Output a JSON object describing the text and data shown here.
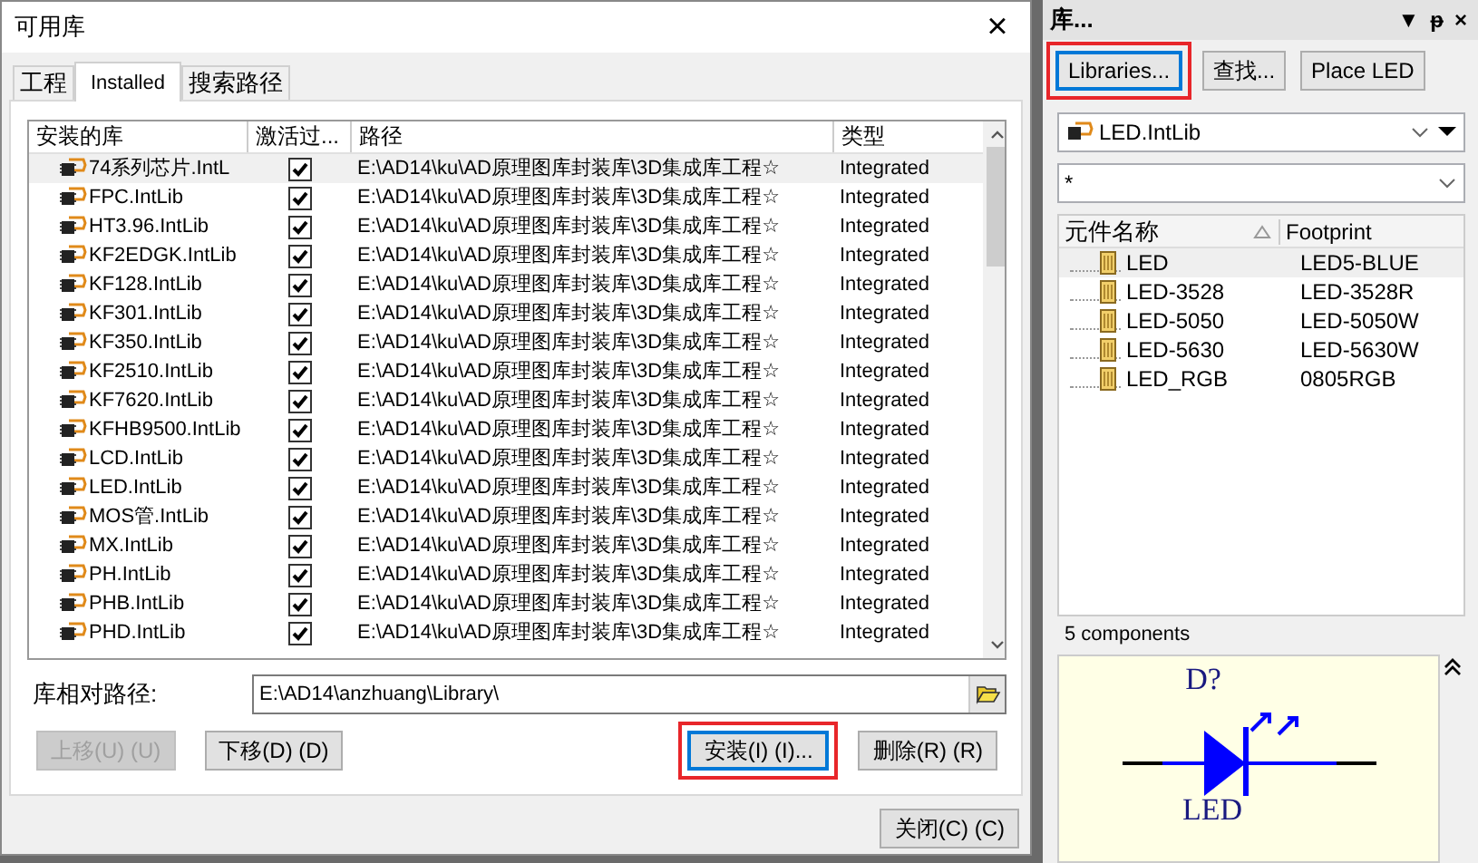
{
  "dialog": {
    "title": "可用库",
    "close": "×",
    "tabs": [
      {
        "label": "工程",
        "selected": false
      },
      {
        "label": "Installed",
        "selected": true
      },
      {
        "label": "搜索路径",
        "selected": false
      }
    ],
    "table": {
      "columns": [
        "安装的库",
        "激活过...",
        "路径",
        "类型"
      ],
      "rows": [
        {
          "name": "74系列芯片.IntL",
          "active": true,
          "path": "E:\\AD14\\ku\\AD原理图库封装库\\3D集成库工程☆",
          "type": "Integrated",
          "selected": true
        },
        {
          "name": "FPC.IntLib",
          "active": true,
          "path": "E:\\AD14\\ku\\AD原理图库封装库\\3D集成库工程☆",
          "type": "Integrated",
          "selected": false
        },
        {
          "name": "HT3.96.IntLib",
          "active": true,
          "path": "E:\\AD14\\ku\\AD原理图库封装库\\3D集成库工程☆",
          "type": "Integrated",
          "selected": false
        },
        {
          "name": "KF2EDGK.IntLib",
          "active": true,
          "path": "E:\\AD14\\ku\\AD原理图库封装库\\3D集成库工程☆",
          "type": "Integrated",
          "selected": false
        },
        {
          "name": "KF128.IntLib",
          "active": true,
          "path": "E:\\AD14\\ku\\AD原理图库封装库\\3D集成库工程☆",
          "type": "Integrated",
          "selected": false
        },
        {
          "name": "KF301.IntLib",
          "active": true,
          "path": "E:\\AD14\\ku\\AD原理图库封装库\\3D集成库工程☆",
          "type": "Integrated",
          "selected": false
        },
        {
          "name": "KF350.IntLib",
          "active": true,
          "path": "E:\\AD14\\ku\\AD原理图库封装库\\3D集成库工程☆",
          "type": "Integrated",
          "selected": false
        },
        {
          "name": "KF2510.IntLib",
          "active": true,
          "path": "E:\\AD14\\ku\\AD原理图库封装库\\3D集成库工程☆",
          "type": "Integrated",
          "selected": false
        },
        {
          "name": "KF7620.IntLib",
          "active": true,
          "path": "E:\\AD14\\ku\\AD原理图库封装库\\3D集成库工程☆",
          "type": "Integrated",
          "selected": false
        },
        {
          "name": "KFHB9500.IntLib",
          "active": true,
          "path": "E:\\AD14\\ku\\AD原理图库封装库\\3D集成库工程☆",
          "type": "Integrated",
          "selected": false
        },
        {
          "name": "LCD.IntLib",
          "active": true,
          "path": "E:\\AD14\\ku\\AD原理图库封装库\\3D集成库工程☆",
          "type": "Integrated",
          "selected": false
        },
        {
          "name": "LED.IntLib",
          "active": true,
          "path": "E:\\AD14\\ku\\AD原理图库封装库\\3D集成库工程☆",
          "type": "Integrated",
          "selected": false
        },
        {
          "name": "MOS管.IntLib",
          "active": true,
          "path": "E:\\AD14\\ku\\AD原理图库封装库\\3D集成库工程☆",
          "type": "Integrated",
          "selected": false
        },
        {
          "name": "MX.IntLib",
          "active": true,
          "path": "E:\\AD14\\ku\\AD原理图库封装库\\3D集成库工程☆",
          "type": "Integrated",
          "selected": false
        },
        {
          "name": "PH.IntLib",
          "active": true,
          "path": "E:\\AD14\\ku\\AD原理图库封装库\\3D集成库工程☆",
          "type": "Integrated",
          "selected": false
        },
        {
          "name": "PHB.IntLib",
          "active": true,
          "path": "E:\\AD14\\ku\\AD原理图库封装库\\3D集成库工程☆",
          "type": "Integrated",
          "selected": false
        },
        {
          "name": "PHD.IntLib",
          "active": true,
          "path": "E:\\AD14\\ku\\AD原理图库封装库\\3D集成库工程☆",
          "type": "Integrated",
          "selected": false
        }
      ]
    },
    "path_label": "库相对路径:",
    "path_value": "E:\\AD14\\anzhuang\\Library\\",
    "buttons": [
      {
        "label": "上移(U) (U)",
        "disabled": true,
        "highlighted": false
      },
      {
        "label": "下移(D) (D)",
        "disabled": false,
        "highlighted": false
      },
      {
        "label": "安装(I) (I)...",
        "disabled": false,
        "highlighted": true
      },
      {
        "label": "删除(R) (R)",
        "disabled": false,
        "highlighted": false
      }
    ],
    "close_button": "关闭(C) (C)"
  },
  "panel": {
    "title": "库...",
    "menu": "▼",
    "pin": "ᵽ",
    "close": "×",
    "buttons": [
      {
        "label": "Libraries...",
        "highlighted": true
      },
      {
        "label": "查找...",
        "highlighted": false
      },
      {
        "label": "Place LED",
        "highlighted": false
      }
    ],
    "library": "LED.IntLib",
    "filter": "*",
    "columns": [
      "元件名称",
      "Footprint"
    ],
    "rows": [
      {
        "name": "LED",
        "footprint": "LED5-BLUE",
        "selected": true
      },
      {
        "name": "LED-3528",
        "footprint": "LED-3528R",
        "selected": false
      },
      {
        "name": "LED-5050",
        "footprint": "LED-5050W",
        "selected": false
      },
      {
        "name": "LED-5630",
        "footprint": "LED-5630W",
        "selected": false
      },
      {
        "name": "LED_RGB",
        "footprint": "0805RGB",
        "selected": false
      }
    ],
    "count": "5 components",
    "preview": {
      "designator": "D?",
      "comment": "LED"
    }
  }
}
